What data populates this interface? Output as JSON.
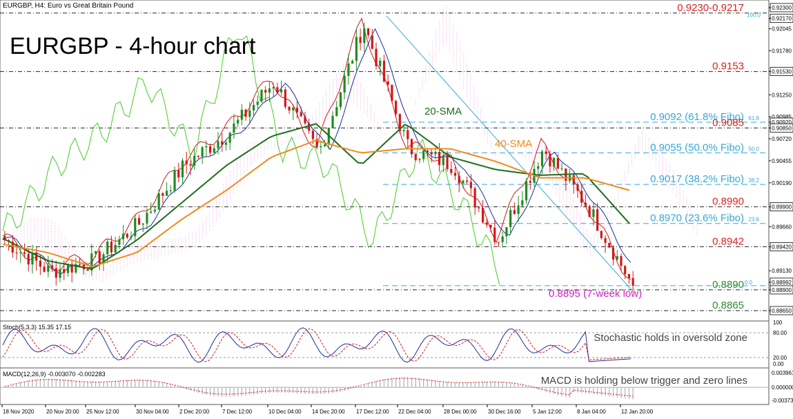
{
  "header": {
    "symbol_line": "EURGBP, H4: Euro vs Great Britain Pound",
    "big_title": "EURGBP - 4-hour chart"
  },
  "price_axis_labels": [
    "0.92300",
    "0.92170",
    "0.92045",
    "0.91780",
    "0.91530",
    "0.91250",
    "0.90985",
    "0.90920",
    "0.90850",
    "0.90720",
    "0.90455",
    "0.90190",
    "0.89900",
    "0.89660",
    "0.89420",
    "0.89130",
    "0.88992",
    "0.88900",
    "0.88650"
  ],
  "levels": [
    {
      "label": "0.9230-0.9217",
      "value": 0.92235,
      "color": "#e0201e",
      "style": "dashdot"
    },
    {
      "label": "0.9153",
      "value": 0.9153,
      "color": "#e0201e",
      "style": "dashdot"
    },
    {
      "label": "0.9092 (61.8% Fibo)",
      "value": 0.9092,
      "color": "#37a7d6",
      "style": "dash",
      "fib_tag": "61.8"
    },
    {
      "label": "0.9085",
      "value": 0.9085,
      "color": "#e0201e",
      "style": "dashdot"
    },
    {
      "label": "0.9055 (50.0% Fibo)",
      "value": 0.9055,
      "color": "#37a7d6",
      "style": "dash",
      "fib_tag": "50.0"
    },
    {
      "label": "0.9017 (38.2% Fibo)",
      "value": 0.9017,
      "color": "#37a7d6",
      "style": "dash",
      "fib_tag": "38.2"
    },
    {
      "label": "0.8990",
      "value": 0.899,
      "color": "#e0201e",
      "style": "dashdot"
    },
    {
      "label": "0.8970 (23.6% Fibo)",
      "value": 0.897,
      "color": "#37a7d6",
      "style": "dash",
      "fib_tag": "23.6"
    },
    {
      "label": "0.8942",
      "value": 0.8942,
      "color": "#e0201e",
      "style": "dashdot"
    },
    {
      "label": "0.8890",
      "value": 0.889,
      "color": "#2e8b2e",
      "style": "dashdot"
    },
    {
      "label": "0.8865",
      "value": 0.8865,
      "color": "#2e8b2e",
      "style": "dashdot"
    }
  ],
  "annotations": {
    "sma20": "20-SMA",
    "sma40": "40-SMA",
    "low": "0.8895 (7-week low)",
    "fib_top_tag": "100.0",
    "fib_zero_tag": "0.0",
    "stoch_note": "Stochastic holds in oversold zone",
    "macd_note": "MACD is holding below trigger and zero lines"
  },
  "stoch": {
    "label": "Stoch(5,3,3) 15.35 17.15",
    "axis": [
      "100",
      "80.00",
      "20.00",
      "0.00"
    ]
  },
  "macd": {
    "label": "MACD(12,26,9) -0.003070 -0.002283",
    "axis": [
      "0.003961",
      "0.000000",
      "-0.003738"
    ]
  },
  "x_axis_labels": [
    "18 Nov 2020",
    "20 Nov 20:00",
    "25 Nov 12:00",
    "30 Nov 04:00",
    "2 Dec 20:00",
    "7 Dec 12:00",
    "10 Dec 04:00",
    "14 Dec 20:00",
    "17 Dec 12:00",
    "22 Dec 04:00",
    "28 Dec 00:00",
    "30 Dec 16:00",
    "5 Jan 12:00",
    "8 Jan 04:00",
    "12 Jan 20:00"
  ],
  "colors": {
    "bull": "#1e8b1e",
    "bear": "#d01818",
    "sma20": "#1b6e1b",
    "sma40": "#f08a1a",
    "fib": "#37a7d6",
    "kumo": "#e060c0",
    "stoch_main": "#1a2aa0",
    "stoch_signal": "#d01818",
    "tenkan": "#d01818",
    "kijun": "#1a2aa0",
    "chikou": "#44cc22",
    "macd_hist": "#bbbbbb",
    "macd_sig": "#d01818"
  },
  "chart_data": {
    "type": "line",
    "title": "EURGBP - 4-hour chart",
    "ylim": [
      0.8855,
      0.9235
    ],
    "x": [
      "18 Nov 2020",
      "20 Nov 20:00",
      "25 Nov 12:00",
      "30 Nov 04:00",
      "2 Dec 20:00",
      "7 Dec 12:00",
      "10 Dec 04:00",
      "14 Dec 20:00",
      "17 Dec 12:00",
      "22 Dec 04:00",
      "28 Dec 00:00",
      "30 Dec 16:00",
      "5 Jan 12:00",
      "8 Jan 04:00",
      "12 Jan 20:00"
    ],
    "series": [
      {
        "name": "20-SMA",
        "values": [
          0.8952,
          0.8925,
          0.8915,
          0.895,
          0.8995,
          0.904,
          0.9075,
          0.909,
          0.904,
          0.909,
          0.905,
          0.9035,
          0.9028,
          0.903,
          0.897
        ]
      },
      {
        "name": "40-SMA",
        "values": [
          0.8945,
          0.8935,
          0.8918,
          0.8935,
          0.8975,
          0.901,
          0.905,
          0.907,
          0.9055,
          0.906,
          0.906,
          0.9045,
          0.9025,
          0.9025,
          0.901
        ]
      }
    ],
    "close": [
      0.895,
      0.8912,
      0.8925,
      0.897,
      0.904,
      0.908,
      0.914,
      0.9055,
      0.921,
      0.906,
      0.904,
      0.895,
      0.906,
      0.899,
      0.8895
    ]
  }
}
